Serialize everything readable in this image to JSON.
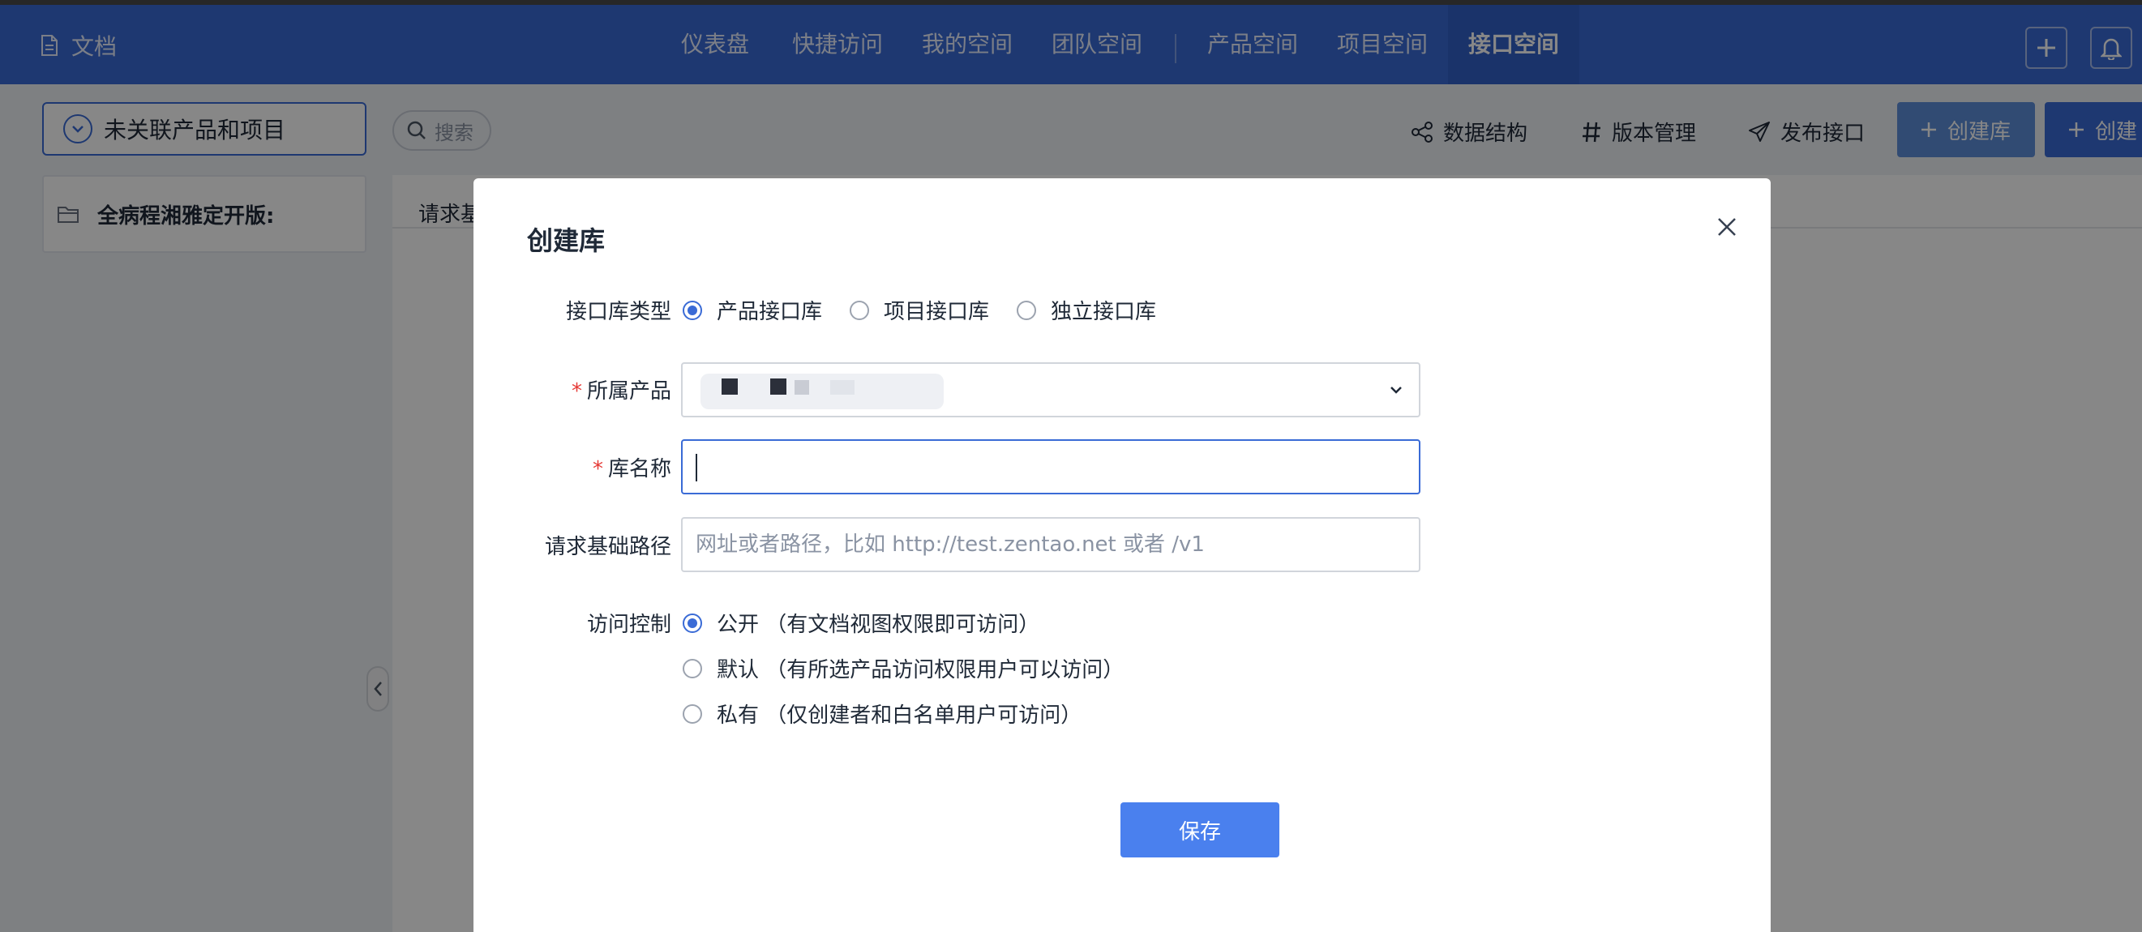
{
  "app": {
    "brand": "文档"
  },
  "nav": {
    "items": [
      {
        "label": "仪表盘"
      },
      {
        "label": "快捷访问"
      },
      {
        "label": "我的空间"
      },
      {
        "label": "团队空间"
      },
      {
        "label": "产品空间"
      },
      {
        "label": "项目空间"
      },
      {
        "label": "接口空间",
        "active": true
      }
    ]
  },
  "toolbar": {
    "scope_select": "未关联产品和项目",
    "search_placeholder": "搜索",
    "data_structure": "数据结构",
    "version_manage": "版本管理",
    "publish_api": "发布接口",
    "create_lib": "创建库",
    "create_other": "创建"
  },
  "sidebar": {
    "item": "全病程湘雅定开版:"
  },
  "main": {
    "label": "请求基"
  },
  "modal": {
    "title": "创建库",
    "lib_type": {
      "label": "接口库类型",
      "options": [
        "产品接口库",
        "项目接口库",
        "独立接口库"
      ],
      "selected": "产品接口库"
    },
    "product": {
      "label": "所属产品",
      "required": true
    },
    "lib_name": {
      "label": "库名称",
      "required": true,
      "value": ""
    },
    "base_path": {
      "label": "请求基础路径",
      "placeholder": "网址或者路径，比如 http://test.zentao.net 或者 /v1"
    },
    "access": {
      "label": "访问控制",
      "options": [
        "公开 （有文档视图权限即可访问）",
        "默认 （有所选产品访问权限用户可以访问）",
        "私有 （仅创建者和白名单用户可访问）"
      ],
      "selected_index": 0
    },
    "save": "保存"
  },
  "colors": {
    "primary": "#3a6bd6",
    "primary_button": "#4a80ee",
    "required": "#e53935"
  }
}
